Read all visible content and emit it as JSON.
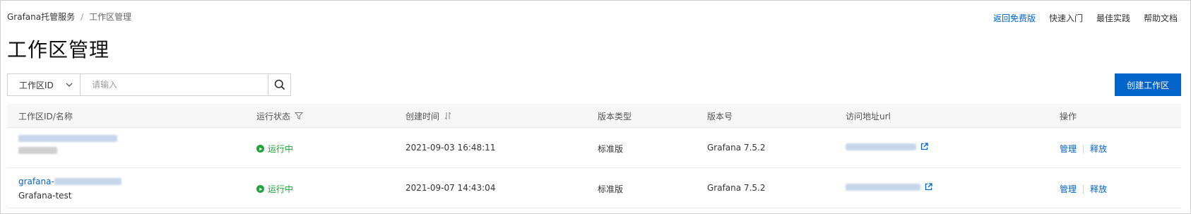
{
  "breadcrumb": {
    "root": "Grafana托管服务",
    "separator": "/",
    "current": "工作区管理"
  },
  "top_links": [
    {
      "label": "返回免费版",
      "primary": true
    },
    {
      "label": "快速入门",
      "primary": false
    },
    {
      "label": "最佳实践",
      "primary": false
    },
    {
      "label": "帮助文档",
      "primary": false
    }
  ],
  "page_title": "工作区管理",
  "search": {
    "field_select": "工作区ID",
    "placeholder": "请输入"
  },
  "create_button": "创建工作区",
  "table": {
    "headers": {
      "id_name": "工作区ID/名称",
      "status": "运行状态",
      "created": "创建时间",
      "edition": "版本类型",
      "version": "版本号",
      "url": "访问地址url",
      "actions": "操作"
    },
    "rows": [
      {
        "id_prefix": "",
        "name": "",
        "status": "运行中",
        "created": "2021-09-03 16:48:11",
        "edition": "标准版",
        "version": "Grafana 7.5.2",
        "action_manage": "管理",
        "action_release": "释放"
      },
      {
        "id_prefix": "grafana-",
        "name": "Grafana-test",
        "status": "运行中",
        "created": "2021-09-07 14:43:04",
        "edition": "标准版",
        "version": "Grafana 7.5.2",
        "action_manage": "管理",
        "action_release": "释放"
      }
    ]
  },
  "colors": {
    "primary": "#0064c8",
    "running": "#1fa33a"
  },
  "icons": [
    "chevron-down-icon",
    "search-icon",
    "filter-icon",
    "sort-icon",
    "play-circle-icon",
    "external-link-icon"
  ]
}
